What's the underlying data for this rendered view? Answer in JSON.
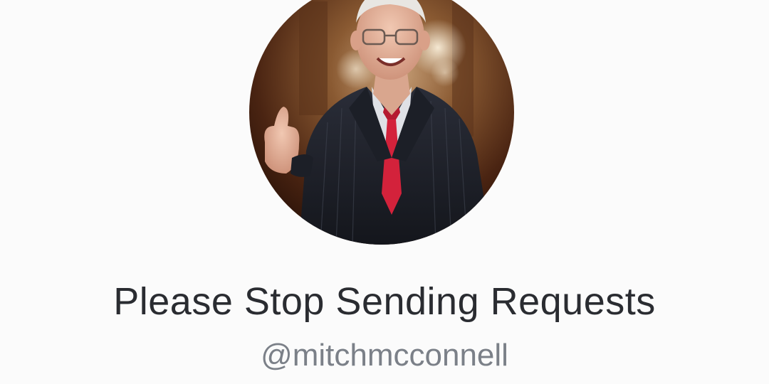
{
  "profile": {
    "display_name": "Please Stop Sending Requests",
    "username": "@mitchmcconnell",
    "avatar_icon": "profile-photo"
  },
  "colors": {
    "background": "#fbfbfb",
    "display_name": "#2a2c31",
    "username": "#7b8088"
  }
}
